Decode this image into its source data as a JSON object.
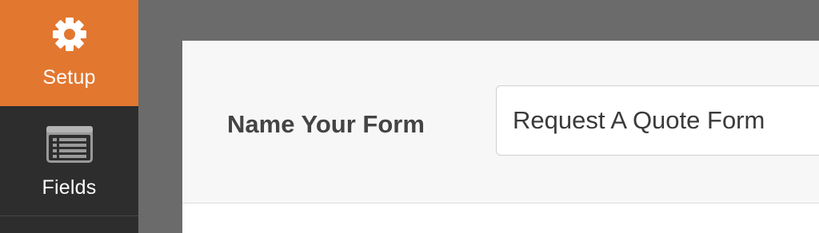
{
  "sidebar": {
    "items": [
      {
        "label": "Setup",
        "icon": "gear-icon",
        "active": true
      },
      {
        "label": "Fields",
        "icon": "fields-list-icon",
        "active": false
      }
    ]
  },
  "form_name": {
    "label": "Name Your Form",
    "value": "Request A Quote Form"
  },
  "colors": {
    "accent": "#e27730",
    "sidebar": "#2d2d2d",
    "backdrop": "#6b6b6b"
  }
}
